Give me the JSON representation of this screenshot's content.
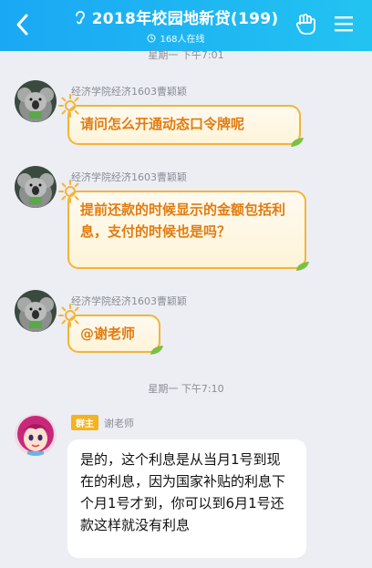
{
  "header": {
    "title": "2018年校园地新贷(199)",
    "subtitle": "168人在线",
    "colors": {
      "bar": "#1aa8f4",
      "text": "#ffffff"
    }
  },
  "time_dividers": [
    "星期一 下午7:01",
    "星期一 下午7:10"
  ],
  "messages": [
    {
      "sender": "经济学院经济1603曹颖颖",
      "text": "请问怎么开通动态口令牌呢"
    },
    {
      "sender": "经济学院经济1603曹颖颖",
      "text": "提前还款的时候显示的金额包括利息，支付的时候也是吗？"
    },
    {
      "sender": "经济学院经济1603曹颖颖",
      "text": "@谢老师"
    },
    {
      "badge": "群主",
      "sender": "谢老师",
      "text": "是的，这个利息是从当月1号到现在的利息，因为国家补贴的利息下个月1号才到，你可以到6月1号还款这样就没有利息"
    }
  ]
}
